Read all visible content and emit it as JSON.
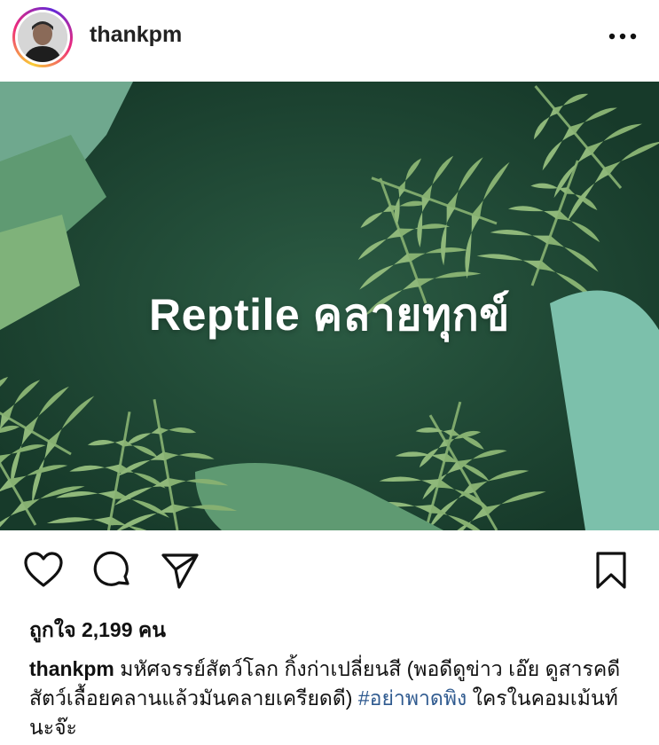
{
  "post": {
    "username": "thankpm",
    "image_title": "Reptile คลายทุกข์",
    "likes_text": "ถูกใจ 2,199 คน",
    "caption": {
      "username": "thankpm",
      "text_before_tag": " มหัศจรรย์สัตว์โลก กิ้งก่าเปลี่ยนสี (พอดีดูข่าว เอ๊ย ดูสารคดีสัตว์เลื้อยคลานแล้วมันคลายเครียดดี) ",
      "hashtag": "#อย่าพาดพิง",
      "text_after_tag": " ใครในคอมเม้นท์นะจ๊ะ"
    }
  },
  "icons": {
    "more": "more-horizontal-icon",
    "like": "heart-icon",
    "comment": "comment-icon",
    "share": "share-icon",
    "save": "bookmark-icon"
  },
  "colors": {
    "hashtag": "#2f5a8f",
    "image_background": "#1f4a36",
    "leaf_light": "#8fb87a",
    "leaf_mid": "#6e9c64",
    "leaf_teal": "#6fb4a3"
  }
}
